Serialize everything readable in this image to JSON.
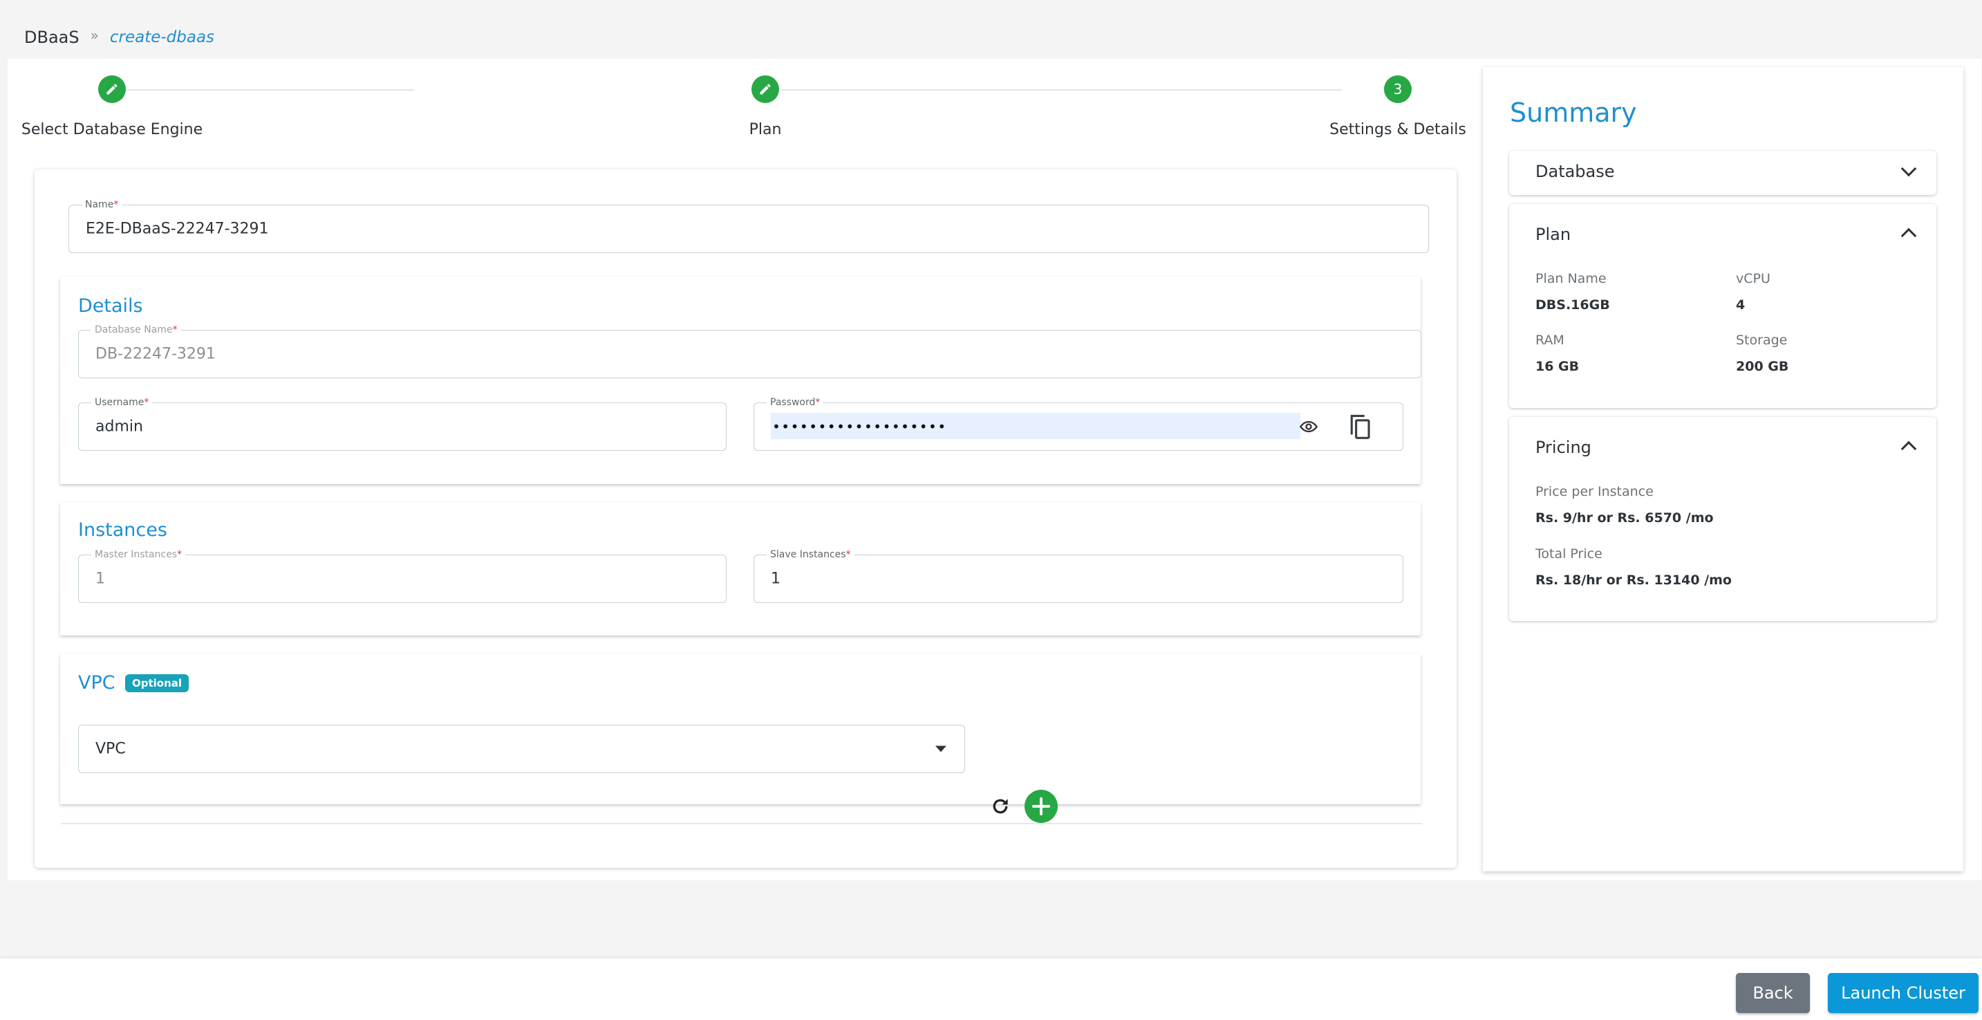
{
  "breadcrumb": {
    "root": "DBaaS",
    "separator": "»",
    "current": "create-dbaas"
  },
  "stepper": {
    "steps": [
      {
        "label": "Select Database Engine",
        "state": "completed",
        "icon": "pencil-icon"
      },
      {
        "label": "Plan",
        "state": "completed",
        "icon": "pencil-icon"
      },
      {
        "label": "Settings & Details",
        "state": "active",
        "number": "3"
      }
    ]
  },
  "form": {
    "name": {
      "label": "Name",
      "required": "*",
      "value": "E2E-DBaaS-22247-3291"
    },
    "details": {
      "title": "Details",
      "database_name": {
        "label": "Database Name",
        "required": "*",
        "value": "DB-22247-3291",
        "disabled": true
      },
      "username": {
        "label": "Username",
        "required": "*",
        "value": "admin"
      },
      "password": {
        "label": "Password",
        "required": "*",
        "masked_value": "•••••••••••••••••••",
        "icons": [
          "eye-icon",
          "copy-icon"
        ]
      }
    },
    "instances": {
      "title": "Instances",
      "master": {
        "label": "Master Instances",
        "required": "*",
        "value": "1",
        "disabled": true
      },
      "slave": {
        "label": "Slave Instances",
        "required": "*",
        "value": "1"
      }
    },
    "vpc": {
      "title": "VPC",
      "badge": "Optional",
      "select_value": "VPC",
      "icons": [
        "refresh-icon",
        "add-icon"
      ]
    }
  },
  "summary": {
    "title": "Summary",
    "database": {
      "header": "Database",
      "expanded": false
    },
    "plan": {
      "header": "Plan",
      "expanded": true,
      "plan_name_label": "Plan Name",
      "plan_name": "DBS.16GB",
      "vcpu_label": "vCPU",
      "vcpu": "4",
      "ram_label": "RAM",
      "ram": "16 GB",
      "storage_label": "Storage",
      "storage": "200 GB"
    },
    "pricing": {
      "header": "Pricing",
      "expanded": true,
      "per_instance_label": "Price per Instance",
      "per_instance": "Rs. 9/hr or Rs. 6570 /mo",
      "total_label": "Total Price",
      "total": "Rs. 18/hr or Rs. 13140 /mo"
    }
  },
  "footer": {
    "back_label": "Back",
    "launch_label": "Launch Cluster"
  },
  "colors": {
    "accent": "#1e8fd1",
    "success": "#28a745",
    "badge": "#17a2b8",
    "back_button": "#6c757d",
    "launch_button": "#0b98d9"
  }
}
